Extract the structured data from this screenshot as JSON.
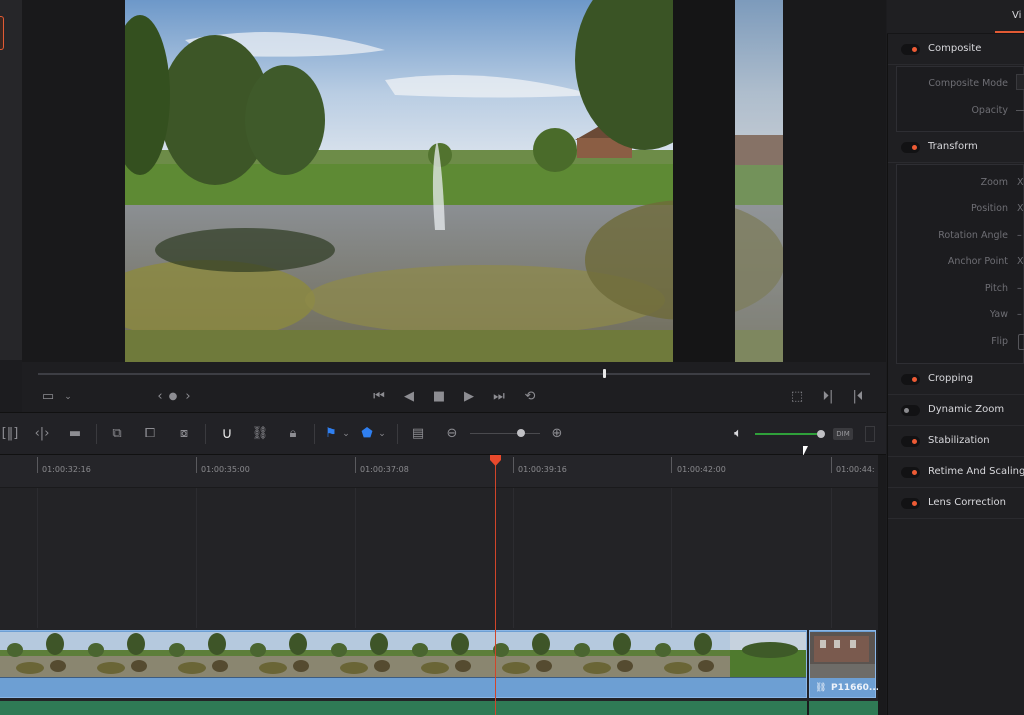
{
  "viewer": {
    "transport": [
      "skip-to-start",
      "step-back",
      "stop",
      "play",
      "skip-to-end",
      "loop"
    ],
    "playhead_progress": 0.683,
    "volume_level": 1.0,
    "dim_label": "DIM"
  },
  "timeline": {
    "timecodes": [
      "01:00:32:16",
      "01:00:35:00",
      "01:00:37:08",
      "01:00:39:16",
      "01:00:42:00",
      "01:00:44:"
    ],
    "playhead_timecode_position": "between 01:00:37:08 and 01:00:39:16",
    "clips": [
      {
        "name": "",
        "color": "#6d9fd3"
      },
      {
        "name": "P11660...",
        "color": "#6d9fd3",
        "linked": true
      }
    ],
    "audio_color": "#2f7a55"
  },
  "inspector": {
    "tab_label": "Vi",
    "sections": [
      {
        "label": "Composite",
        "enabled": true,
        "props": [
          {
            "label": "Composite Mode"
          },
          {
            "label": "Opacity"
          }
        ]
      },
      {
        "label": "Transform",
        "enabled": true,
        "props": [
          {
            "label": "Zoom",
            "value": "X"
          },
          {
            "label": "Position",
            "value": "X"
          },
          {
            "label": "Rotation Angle",
            "value": "–"
          },
          {
            "label": "Anchor Point",
            "value": "X"
          },
          {
            "label": "Pitch",
            "value": "–"
          },
          {
            "label": "Yaw",
            "value": "–"
          },
          {
            "label": "Flip",
            "value": ""
          }
        ]
      },
      {
        "label": "Cropping",
        "enabled": true
      },
      {
        "label": "Dynamic Zoom",
        "enabled": false
      },
      {
        "label": "Stabilization",
        "enabled": true
      },
      {
        "label": "Retime And Scaling",
        "enabled": true
      },
      {
        "label": "Lens Correction",
        "enabled": true
      }
    ]
  },
  "colors": {
    "accent": "#e25a34",
    "flag_blue": "#2f7ff0",
    "volume_green": "#2fa03a"
  }
}
